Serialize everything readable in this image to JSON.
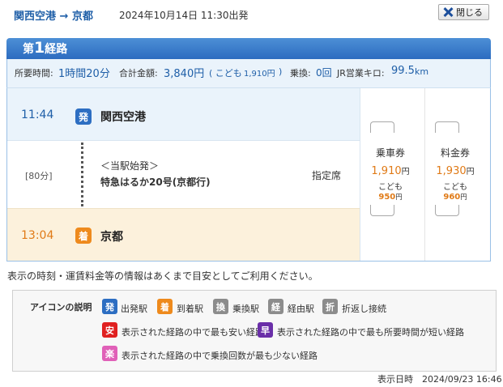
{
  "header": {
    "route": "関西空港 → 京都",
    "datetime": "2024年10月14日 11:30出発",
    "close_label": "閉じる"
  },
  "route_tab": {
    "prefix": "第",
    "number": "1",
    "suffix": "経路"
  },
  "summary": {
    "time_label": "所要時間:",
    "time_value": "1時間20分",
    "fare_label": "合計金額:",
    "fare_value": "3,840円",
    "child_open": "( こども",
    "child_value": "1,910円",
    "child_close": ")",
    "transfer_label": "乗換:",
    "transfer_value": "0回",
    "distance_label": "JR営業キロ:",
    "distance_value": "99.5",
    "distance_unit": "km"
  },
  "departure": {
    "time": "11:44",
    "badge": "発",
    "station": "関西空港"
  },
  "segment": {
    "duration": "[80分]",
    "origin_note": "＜当駅始発＞",
    "train": "特急はるか20号(京都行)",
    "seat": "指定席"
  },
  "arrival": {
    "time": "13:04",
    "badge": "着",
    "station": "京都"
  },
  "fares": [
    {
      "name": "乗車券",
      "amount": "1,910",
      "unit": "円",
      "child_label": "こども",
      "child_amount": "950",
      "child_unit": "円"
    },
    {
      "name": "料金券",
      "amount": "1,930",
      "unit": "円",
      "child_label": "こども",
      "child_amount": "960",
      "child_unit": "円"
    }
  ],
  "note": "表示の時刻・運賃料金等の情報はあくまで目安としてご利用ください。",
  "legend": {
    "title": "アイコンの説明",
    "items": [
      {
        "badge": "発",
        "label": "出発駅",
        "color": "#2d6ec2"
      },
      {
        "badge": "着",
        "label": "到着駅",
        "color": "#ee8a1d"
      },
      {
        "badge": "換",
        "label": "乗換駅",
        "color": "#8c8c8c"
      },
      {
        "badge": "経",
        "label": "経由駅",
        "color": "#8c8c8c"
      },
      {
        "badge": "折",
        "label": "折返し接続",
        "color": "#8c8c8c"
      },
      {
        "badge": "安",
        "label": "表示された経路の中で最も安い経路",
        "color": "#e02020"
      },
      {
        "badge": "早",
        "label": "表示された経路の中で最も所要時間が短い経路",
        "color": "#6a2fa8"
      },
      {
        "badge": "楽",
        "label": "表示された経路の中で乗換回数が最も少ない経路",
        "color": "#e060b8"
      }
    ]
  },
  "footer": "表示日時　2024/09/23 16:46"
}
